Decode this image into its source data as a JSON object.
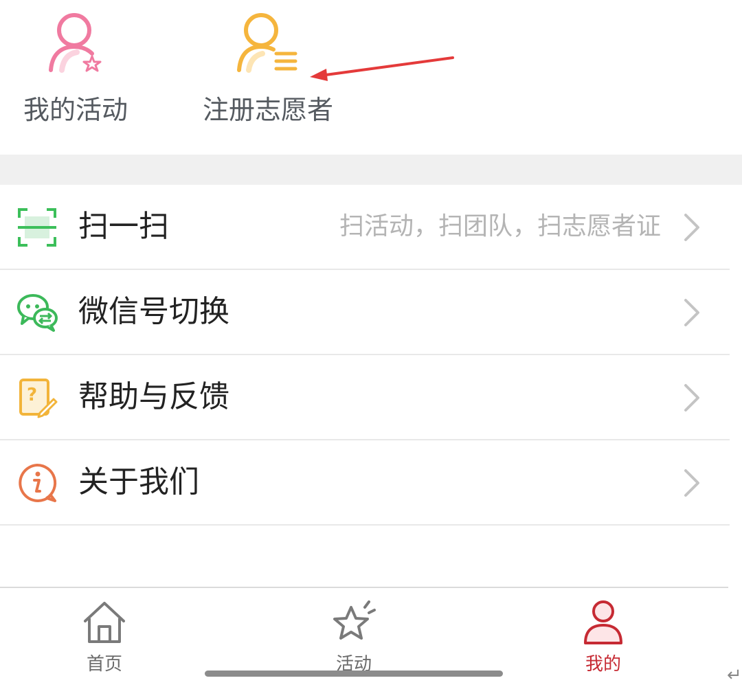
{
  "quick_actions": {
    "my_activities_label": "我的活动",
    "register_volunteer_label": "注册志愿者"
  },
  "menu": [
    {
      "label": "扫一扫",
      "hint": "扫活动，扫团队，扫志愿者证",
      "icon": "scan-icon"
    },
    {
      "label": "微信号切换",
      "hint": "",
      "icon": "wechat-switch-icon"
    },
    {
      "label": "帮助与反馈",
      "hint": "",
      "icon": "help-feedback-icon"
    },
    {
      "label": "关于我们",
      "hint": "",
      "icon": "info-icon"
    }
  ],
  "tabbar": {
    "home_label": "首页",
    "activity_label": "活动",
    "mine_label": "我的",
    "active_tab": "我的"
  },
  "colors": {
    "accent_red": "#c62a33",
    "activities_icon_pink": "#f07aa0",
    "volunteer_icon_orange": "#f5b53d",
    "scan_green": "#3cbf5a",
    "wechat_green": "#3cb95a",
    "help_yellow": "#f2b43a",
    "info_orange": "#e8764a",
    "annotation_arrow": "#e43a3a"
  },
  "return_glyph": "↵"
}
